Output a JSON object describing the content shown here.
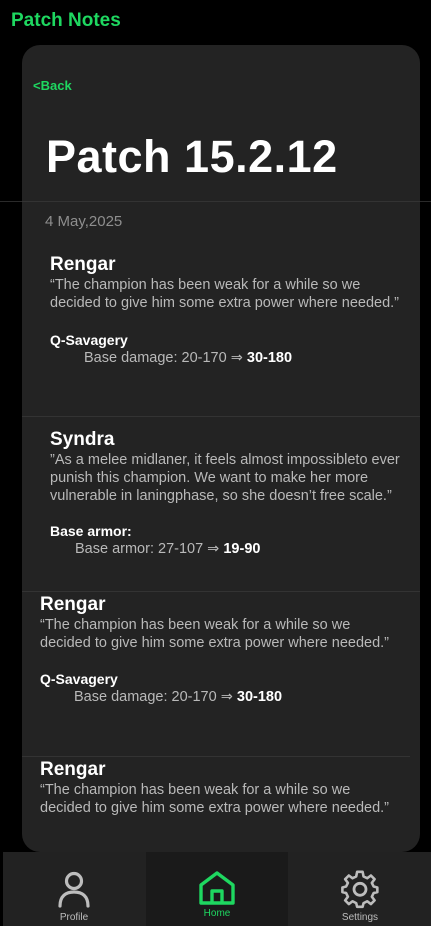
{
  "header": {
    "title": "Patch Notes"
  },
  "card": {
    "back_label": "<Back",
    "patch_title": "Patch 15.2.12",
    "date": "4 May,2025",
    "entries": [
      {
        "champion": "Rengar",
        "quote": "“The champion has been weak for a while so we decided to give him some extra power where needed.”",
        "stat_name": "Q-Savagery",
        "stat_prefix": "Base damage: 20-170 ⇒ ",
        "stat_new": "30-180"
      },
      {
        "champion": "Syndra",
        "quote": "”As a melee midlaner, it feels almost impossibleto ever punish this champion. We want to make her more vulnerable in laningphase, so she doesn’t free scale.”",
        "stat_name": "Base armor:",
        "stat_prefix": "Base armor: 27-107 ⇒ ",
        "stat_new": "19-90"
      },
      {
        "champion": "Rengar",
        "quote": "“The champion has been weak for a while so we decided to give him some extra power where needed.”",
        "stat_name": "Q-Savagery",
        "stat_prefix": "Base damage: 20-170 ⇒ ",
        "stat_new": "30-180"
      },
      {
        "champion": "Rengar",
        "quote": "“The champion has been weak for a while so we decided to give him some extra power where needed.”"
      }
    ]
  },
  "nav": {
    "items": [
      {
        "label": "Profile",
        "icon": "person-icon"
      },
      {
        "label": "Home",
        "icon": "home-icon",
        "active": true
      },
      {
        "label": "Settings",
        "icon": "gear-icon"
      }
    ]
  },
  "colors": {
    "accent": "#1ed760",
    "background": "#000000",
    "card": "#232323",
    "nav": "#222222"
  }
}
